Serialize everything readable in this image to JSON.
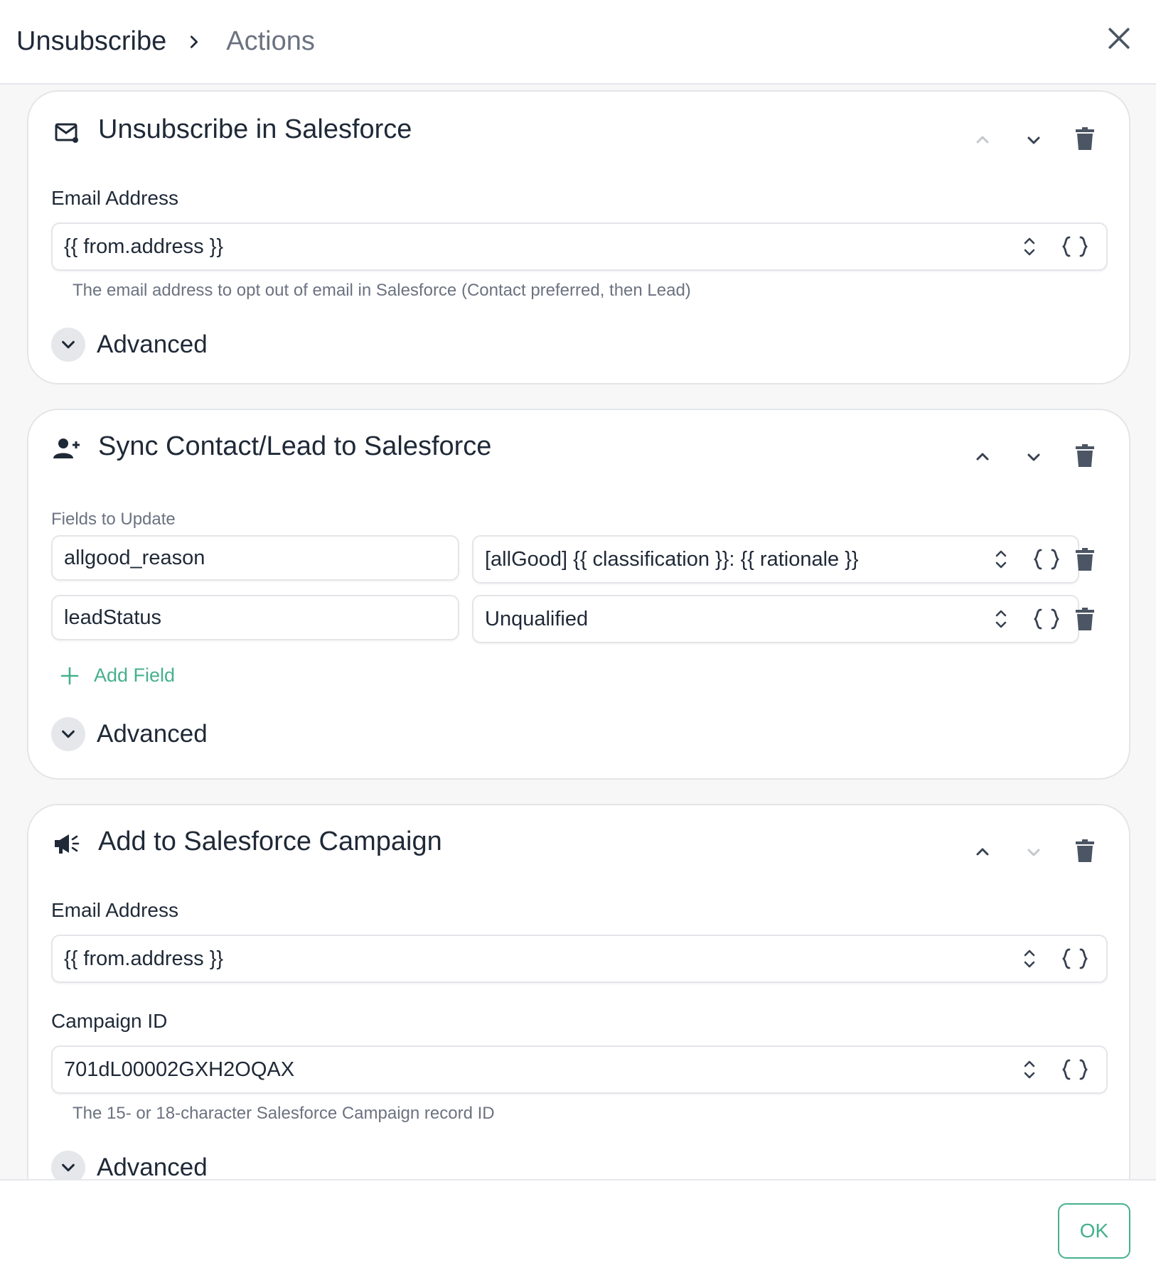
{
  "header": {
    "breadcrumb_root": "Unsubscribe",
    "breadcrumb_current": "Actions"
  },
  "cards": [
    {
      "title": "Unsubscribe in Salesforce",
      "icon": "mail-icon",
      "fields": [
        {
          "label": "Email Address",
          "value": "{{ from.address }}",
          "help": "The email address to opt out of email in Salesforce (Contact preferred, then Lead)"
        }
      ],
      "advanced_label": "Advanced"
    },
    {
      "title": "Sync Contact/Lead to Salesforce",
      "icon": "user-plus-icon",
      "fields_label": "Fields to Update",
      "field_rows": [
        {
          "key": "allgood_reason",
          "value": "[allGood] {{ classification }}: {{ rationale }}"
        },
        {
          "key": "leadStatus",
          "value": "Unqualified"
        }
      ],
      "add_field_label": "Add Field",
      "advanced_label": "Advanced"
    },
    {
      "title": "Add to Salesforce Campaign",
      "icon": "megaphone-icon",
      "fields": [
        {
          "label": "Email Address",
          "value": "{{ from.address }}"
        },
        {
          "label": "Campaign ID",
          "value": "701dL00002GXH2OQAX",
          "help": "The 15- or 18-character Salesforce Campaign record ID"
        }
      ],
      "advanced_label": "Advanced"
    }
  ],
  "footer": {
    "ok_label": "OK"
  },
  "colors": {
    "accent": "#45b08c",
    "text": "#1f2937",
    "muted": "#6b7280",
    "border": "#e3e5e8",
    "background": "#f7f7f7"
  }
}
